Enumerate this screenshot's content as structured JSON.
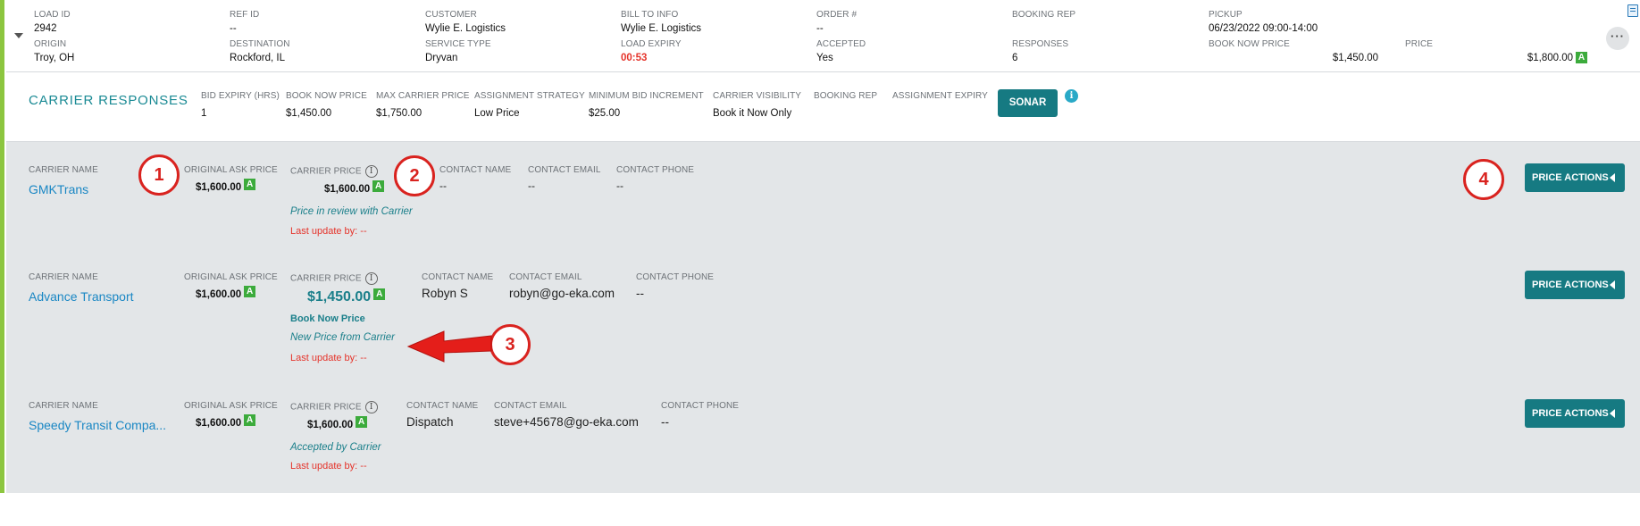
{
  "summary": {
    "load_id": {
      "label": "LOAD ID",
      "value": "2942"
    },
    "ref_id": {
      "label": "REF ID",
      "value": "--"
    },
    "customer": {
      "label": "CUSTOMER",
      "value": "Wylie E. Logistics"
    },
    "bill_to": {
      "label": "BILL TO INFO",
      "value": "Wylie E. Logistics"
    },
    "order": {
      "label": "ORDER #",
      "value": "--"
    },
    "booking_rep": {
      "label": "BOOKING REP",
      "value": ""
    },
    "pickup": {
      "label": "PICKUP",
      "value": "06/23/2022 09:00-14:00"
    },
    "origin": {
      "label": "ORIGIN",
      "value": "Troy, OH"
    },
    "destination": {
      "label": "DESTINATION",
      "value": "Rockford, IL"
    },
    "service_type": {
      "label": "SERVICE TYPE",
      "value": "Dryvan"
    },
    "load_expiry": {
      "label": "LOAD EXPIRY",
      "value": "00:53"
    },
    "accepted": {
      "label": "ACCEPTED",
      "value": "Yes"
    },
    "responses": {
      "label": "RESPONSES",
      "value": "6"
    },
    "book_now_price": {
      "label": "BOOK NOW PRICE",
      "value": "$1,450.00"
    },
    "price": {
      "label": "PRICE",
      "value": "$1,800.00",
      "badge": "A"
    },
    "more_label": "···"
  },
  "carrier_responses": {
    "title": "CARRIER RESPONSES",
    "fields": [
      {
        "label": "BID EXPIRY (HRS)",
        "value": "1"
      },
      {
        "label": "BOOK NOW PRICE",
        "value": "$1,450.00"
      },
      {
        "label": "MAX CARRIER PRICE",
        "value": "$1,750.00"
      },
      {
        "label": "ASSIGNMENT STRATEGY",
        "value": "Low Price"
      },
      {
        "label": "MINIMUM BID INCREMENT",
        "value": "$25.00"
      },
      {
        "label": "CARRIER VISIBILITY",
        "value": "Book it Now Only"
      },
      {
        "label": "BOOKING REP",
        "value": ""
      },
      {
        "label": "ASSIGNMENT EXPIRY",
        "value": ""
      }
    ],
    "sonar_label": "SONAR",
    "info_label": "i"
  },
  "column_labels": {
    "carrier_name": "CARRIER NAME",
    "original_ask": "ORIGINAL ASK PRICE",
    "carrier_price": "CARRIER PRICE",
    "contact_name": "CONTACT NAME",
    "contact_email": "CONTACT EMAIL",
    "contact_phone": "CONTACT PHONE",
    "info_glyph": "i",
    "badge": "A",
    "price_actions": "PRICE ACTIONS"
  },
  "carriers": [
    {
      "name": "GMKTrans",
      "original_ask": "$1,600.00",
      "carrier_price": "$1,600.00",
      "book_now": "",
      "status": "Price in review with Carrier",
      "last_update": "Last update by: --",
      "contact_name": "--",
      "contact_email": "--",
      "contact_phone": "--"
    },
    {
      "name": "Advance Transport",
      "original_ask": "$1,600.00",
      "carrier_price": "$1,450.00",
      "book_now": "Book Now Price",
      "status": "New Price from Carrier",
      "last_update": "Last update by: --",
      "contact_name": "Robyn S",
      "contact_email": "robyn@go-eka.com",
      "contact_phone": "--"
    },
    {
      "name": "Speedy Transit Compa...",
      "original_ask": "$1,600.00",
      "carrier_price": "$1,600.00",
      "book_now": "",
      "status": "Accepted by Carrier",
      "last_update": "Last update by: --",
      "contact_name": "Dispatch",
      "contact_email": "steve+45678@go-eka.com",
      "contact_phone": "--"
    }
  ],
  "annotations": [
    "1",
    "2",
    "3",
    "4"
  ],
  "colors": {
    "accent": "#167a82",
    "link": "#1a87c4",
    "danger": "#e5342b",
    "badge_green": "#3cab3c",
    "row_bg": "#e3e6e8",
    "annotation_red": "#d9231f"
  }
}
